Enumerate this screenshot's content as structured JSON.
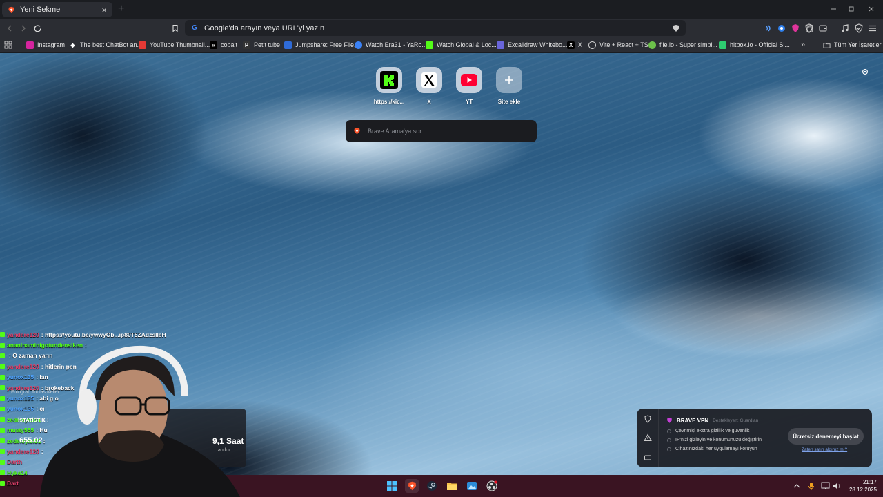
{
  "tab": {
    "title": "Yeni Sekme",
    "close": "×",
    "new": "+"
  },
  "omnibox": {
    "placeholder": "Google'da arayın veya URL'yi yazın"
  },
  "bookmarks": [
    {
      "label": "Instagram",
      "color": "#d6249f"
    },
    {
      "label": "The best ChatBot an...",
      "color": "#ffffff"
    },
    {
      "label": "YouTube Thumbnail...",
      "color": "#e53935"
    },
    {
      "label": "cobalt",
      "color": "#000000"
    },
    {
      "label": "Petit tube",
      "color": "#333333"
    },
    {
      "label": "Jumpshare: Free File...",
      "color": "#2f6bd8"
    },
    {
      "label": "Watch Era31 - YaRo...",
      "color": "#3b82f6"
    },
    {
      "label": "Watch Global & Loc...",
      "color": "#53fc18"
    },
    {
      "label": "Excalidraw Whitebo...",
      "color": "#6965db"
    },
    {
      "label": "X",
      "color": "#000000"
    },
    {
      "label": "Vite + React + TS",
      "color": "#a855f7"
    },
    {
      "label": "file.io - Super simpl...",
      "color": "#6cc04a"
    },
    {
      "label": "hitbox.io - Official Si...",
      "color": "#2ecc71"
    }
  ],
  "all_bookmarks": "Tüm Yer İşaretleri",
  "tiles": [
    {
      "label": "https://kic...",
      "icon": "kick-icon"
    },
    {
      "label": "X",
      "icon": "x-icon"
    },
    {
      "label": "YT",
      "icon": "youtube-icon"
    },
    {
      "label": "Site ekle",
      "icon": "plus-icon"
    }
  ],
  "search": {
    "placeholder": "Brave Arama'ya sor"
  },
  "photo_credit": "Fotoğraf: Tobias Keller",
  "chat": [
    {
      "user": "yandere120",
      "msg": ": https://youtu.be/ywwyOb...ip80T5ZAdzslleH",
      "color": "#e0406a"
    },
    {
      "user": "ananinaminigotundensiken",
      "msg": " :",
      "color": "#53fc18"
    },
    {
      "user": "",
      "msg": ": O zaman yarın",
      "color": "#4fa3ff"
    },
    {
      "user": "yandere120",
      "msg": ": hitlerin pen",
      "color": "#e0406a"
    },
    {
      "user": "yunox135",
      "msg": ": lan",
      "color": "#4fa3ff"
    },
    {
      "user": "yandere120",
      "msg": ": brokeback",
      "color": "#e0406a"
    },
    {
      "user": "yunox135",
      "msg": ": abi g o",
      "color": "#4fa3ff"
    },
    {
      "user": "yunox135",
      "msg": ": ci",
      "color": "#4fa3ff"
    },
    {
      "user": "zedeleyici31",
      "msg": ": :",
      "color": "#53fc18"
    },
    {
      "user": "musty555",
      "msg": ": Hu",
      "color": "#53fc18"
    },
    {
      "user": "zedeleyici31",
      "msg": ":",
      "color": "#53fc18"
    },
    {
      "user": "yandere120",
      "msg": ":",
      "color": "#e0406a"
    },
    {
      "user": "Darth",
      "msg": "",
      "color": "#e0406a"
    },
    {
      "user": "Hyke14",
      "msg": "",
      "color": "#53fc18"
    },
    {
      "user": "Dart",
      "msg": "",
      "color": "#e0406a"
    }
  ],
  "stats": {
    "title": "İSTATİSTİK",
    "time": "655.02",
    "value": "9,1 Saat",
    "sub": "anıldı"
  },
  "vpn": {
    "name": "BRAVE VPN",
    "supported": "Destekleyen: Guardian",
    "features": [
      "Çevrimiçi ekstra gizlilik ve güvenlik",
      "IP'nizi gizleyin ve konumunuzu değiştirin",
      "Cihazınızdaki her uygulamayı koruyun"
    ],
    "button": "Ücretsiz denemeyi başlat",
    "link": "Zaten satın aldınız mı?"
  },
  "clock": {
    "time": "21:17",
    "date": "28.12.2025"
  },
  "colors": {
    "brave": "#fb542b",
    "kick": "#53fc18",
    "youtube": "#ff0033",
    "taskbar": "#3a1422"
  }
}
